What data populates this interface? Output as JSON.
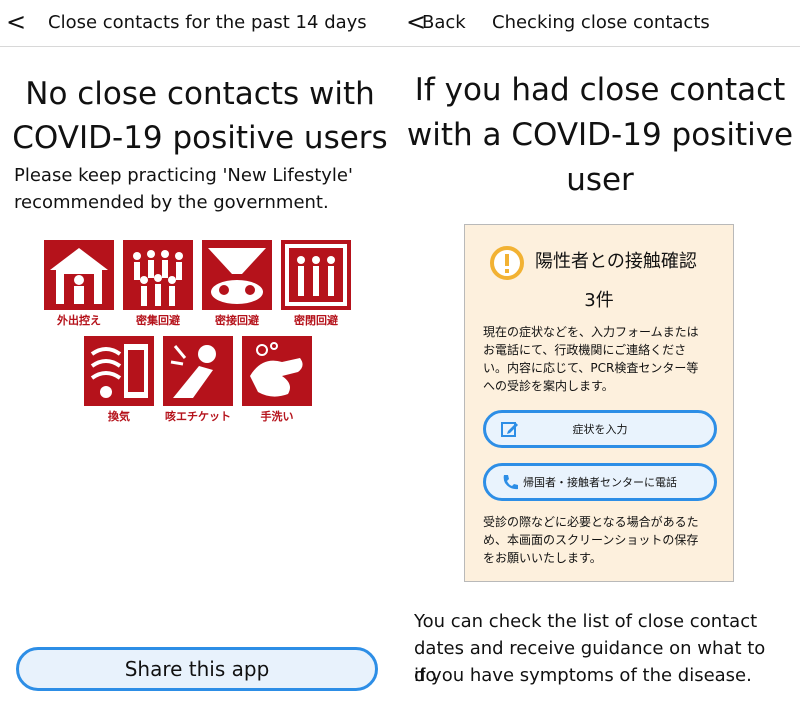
{
  "left": {
    "nav_back": "<",
    "nav_title": "Close contacts for the past 14 days",
    "headline_line1": "No close contacts with",
    "headline_line2": "COVID-19 positive users",
    "body_line1": "Please keep practicing 'New Lifestyle'",
    "body_line2": "recommended by the government.",
    "pictograms": [
      {
        "label": "外出控え",
        "icon": "stay-home-icon"
      },
      {
        "label": "密集回避",
        "icon": "avoid-crowds-icon"
      },
      {
        "label": "密接回避",
        "icon": "avoid-close-contact-icon"
      },
      {
        "label": "密閉回避",
        "icon": "avoid-closed-spaces-icon"
      },
      {
        "label": "換気",
        "icon": "ventilation-icon"
      },
      {
        "label": "咳エチケット",
        "icon": "cough-etiquette-icon"
      },
      {
        "label": "手洗い",
        "icon": "hand-washing-icon"
      }
    ],
    "share_button": "Share this app"
  },
  "right": {
    "nav_back": "<",
    "back_label": "Back",
    "nav_title": "Checking close contacts",
    "headline_line1": "If you had close contact",
    "headline_line2": "with a COVID-19 positive",
    "headline_line3": "user",
    "card": {
      "title": "陽性者との接触確認",
      "count": "3件",
      "text_line1": "現在の症状などを、入力フォームまたは",
      "text_line2": "お電話にて、行政機関にご連絡くださ",
      "text_line3": "い。内容に応じて、PCR検査センター等",
      "text_line4": "への受診を案内します。",
      "button1": "症状を入力",
      "button2": "帰国者・接触者センターに電話",
      "footer_line1": "受診の際などに必要となる場合があるた",
      "footer_line2": "め、本画面のスクリーンショットの保存",
      "footer_line3": "をお願いいたします。"
    },
    "body_line1": "You can check the list of close contact",
    "body_line2": "dates and receive guidance on what to do",
    "body_line3": "if you have symptoms of the disease."
  },
  "colors": {
    "pictogram_red": "#b5121b",
    "accent_blue": "#2d8ee6",
    "card_bg": "#fdf0dd",
    "warning_yellow": "#f2b233"
  }
}
